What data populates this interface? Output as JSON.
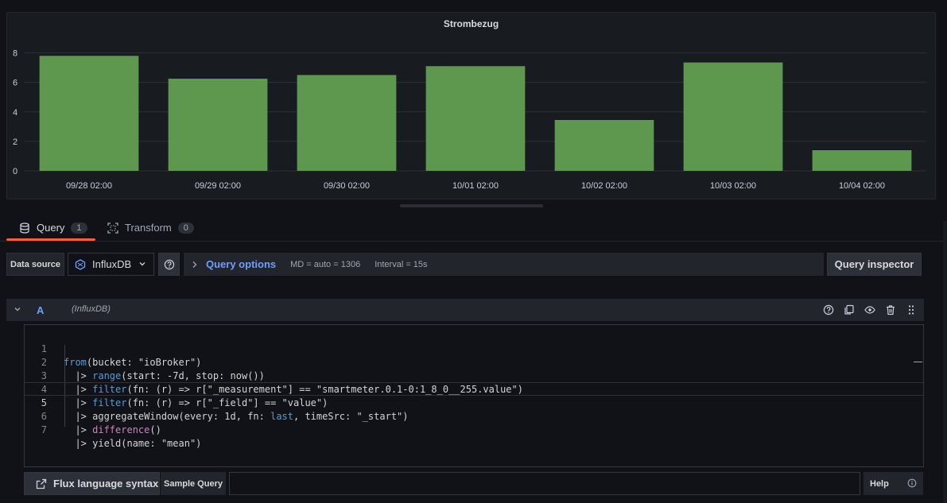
{
  "panel": {
    "title": "Strombezug"
  },
  "chart_data": {
    "type": "bar",
    "title": "Strombezug",
    "categories": [
      "09/28 02:00",
      "09/29 02:00",
      "09/30 02:00",
      "10/01 02:00",
      "10/02 02:00",
      "10/03 02:00",
      "10/04 02:00"
    ],
    "values": [
      7.8,
      6.25,
      6.5,
      7.1,
      3.45,
      7.35,
      1.4
    ],
    "yticks": [
      0,
      2,
      4,
      6,
      8
    ],
    "ylim": [
      0,
      8.3
    ],
    "grid": true,
    "bar_color": "#629e51"
  },
  "tabs": [
    {
      "label": "Query",
      "count": "1",
      "icon": "database-icon"
    },
    {
      "label": "Transform",
      "count": "0",
      "icon": "transform-icon"
    }
  ],
  "toolbar": {
    "datasource_label": "Data source",
    "datasource_value": "InfluxDB",
    "query_options_label": "Query options",
    "md": "MD = auto = 1306",
    "interval": "Interval = 15s",
    "query_inspector": "Query inspector"
  },
  "query": {
    "ref_id": "A",
    "datasource": "(InfluxDB)",
    "lines": [
      {
        "num": "1"
      },
      {
        "num": "2"
      },
      {
        "num": "3"
      },
      {
        "num": "4"
      },
      {
        "num": "5"
      },
      {
        "num": "6"
      },
      {
        "num": "7"
      }
    ],
    "code": {
      "l1_kw": "from",
      "l1_rest": "(bucket: \"ioBroker\")",
      "pipe": "  |> ",
      "l2_kw": "range",
      "l2_rest": "(start: -7d, stop: now())",
      "l3_kw": "filter",
      "l3_rest": "(fn: (r) => r[\"_measurement\"] == \"smartmeter.0.1-0:1_8_0__255.value\")",
      "l4_kw": "filter",
      "l4_rest": "(fn: (r) => r[\"_field\"] == \"value\")",
      "l5_pre": "aggregateWindow(every: 1d, fn: ",
      "l5_kw": "last",
      "l5_post": ", timeSrc: \"_start\")",
      "l6_fn": "difference",
      "l6_rest": "()",
      "l7_rest": "yield(name: \"mean\")"
    }
  },
  "footer": {
    "flux_syntax": "Flux language syntax",
    "sample_query": "Sample Query",
    "help": "Help"
  }
}
